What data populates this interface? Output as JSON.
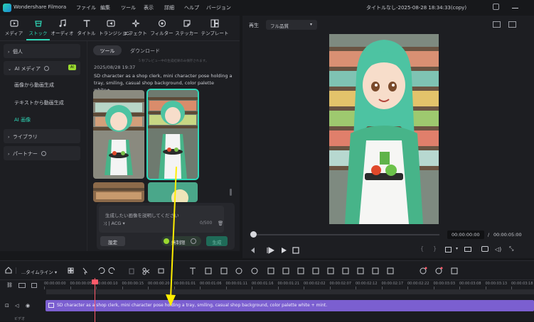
{
  "titlebar": {
    "app_name": "Wondershare Filmora",
    "menus": [
      "ファイル",
      "編集",
      "ツール",
      "表示",
      "詳細",
      "ヘルプ",
      "バージョン"
    ],
    "project_title": "タイトルなし-2025-08-28 18:34:33(copy)"
  },
  "toolbar": {
    "items": [
      "メディア",
      "ストック",
      "オーディオ",
      "タイトル",
      "トランジション",
      "エフェクト",
      "フィルター",
      "ステッカー",
      "テンプレート"
    ]
  },
  "leftnav": {
    "item1": "個人",
    "ai_media": "AI メディア",
    "ai_badge": "AI",
    "sub1": "画像から動画生成",
    "sub2": "テキストから動画生成",
    "sub3": "AI 画像",
    "library": "ライブラリ",
    "partner": "パートナー"
  },
  "midpanel": {
    "tab_tools": "ツール",
    "tab_download": "ダウンロード",
    "note": "5 秒プレビュー中の生成結果のみ保存されます。",
    "date": "2025/08/28 19:37",
    "prompt_text": "SD character as a shop clerk, mini character pose holding a tray, smiling, casual shop background, color palette white+...",
    "input_placeholder": "生成したい画像を説明してください",
    "style_label": "ACG",
    "char_count": "0/500",
    "settings_button": "設定",
    "credit_label": "無制限",
    "generate_button": "生成"
  },
  "preview": {
    "label": "再生",
    "quality": "フル品質",
    "current_time": "00:00:00:00",
    "separator": "/",
    "total_time": "00:00:05:00"
  },
  "timeline": {
    "timeline_label": "...タイムライン",
    "ticks": [
      "00:00:00:00",
      "00:00:00:05",
      "00:00:00:10",
      "00:00:00:15",
      "00:00:00:20",
      "00:00:01:01",
      "00:00:01:06",
      "00:00:01:11",
      "00:00:01:16",
      "00:00:01:21",
      "00:00:02:02",
      "00:00:02:07",
      "00:00:02:12",
      "00:00:02:17",
      "00:00:02:22",
      "00:00:03:03",
      "00:00:03:08",
      "00:00:03:13",
      "00:00:03:18"
    ],
    "clip_text": "SD character as a shop clerk, mini character pose holding a tray, smiling, casual shop background, color palette white + mint.",
    "track_label": "ビデオ"
  },
  "colors": {
    "accent": "#2fd9b9",
    "clip": "#7b5fd0",
    "playhead": "#ff5a6a",
    "arrow": "#ffee00"
  }
}
